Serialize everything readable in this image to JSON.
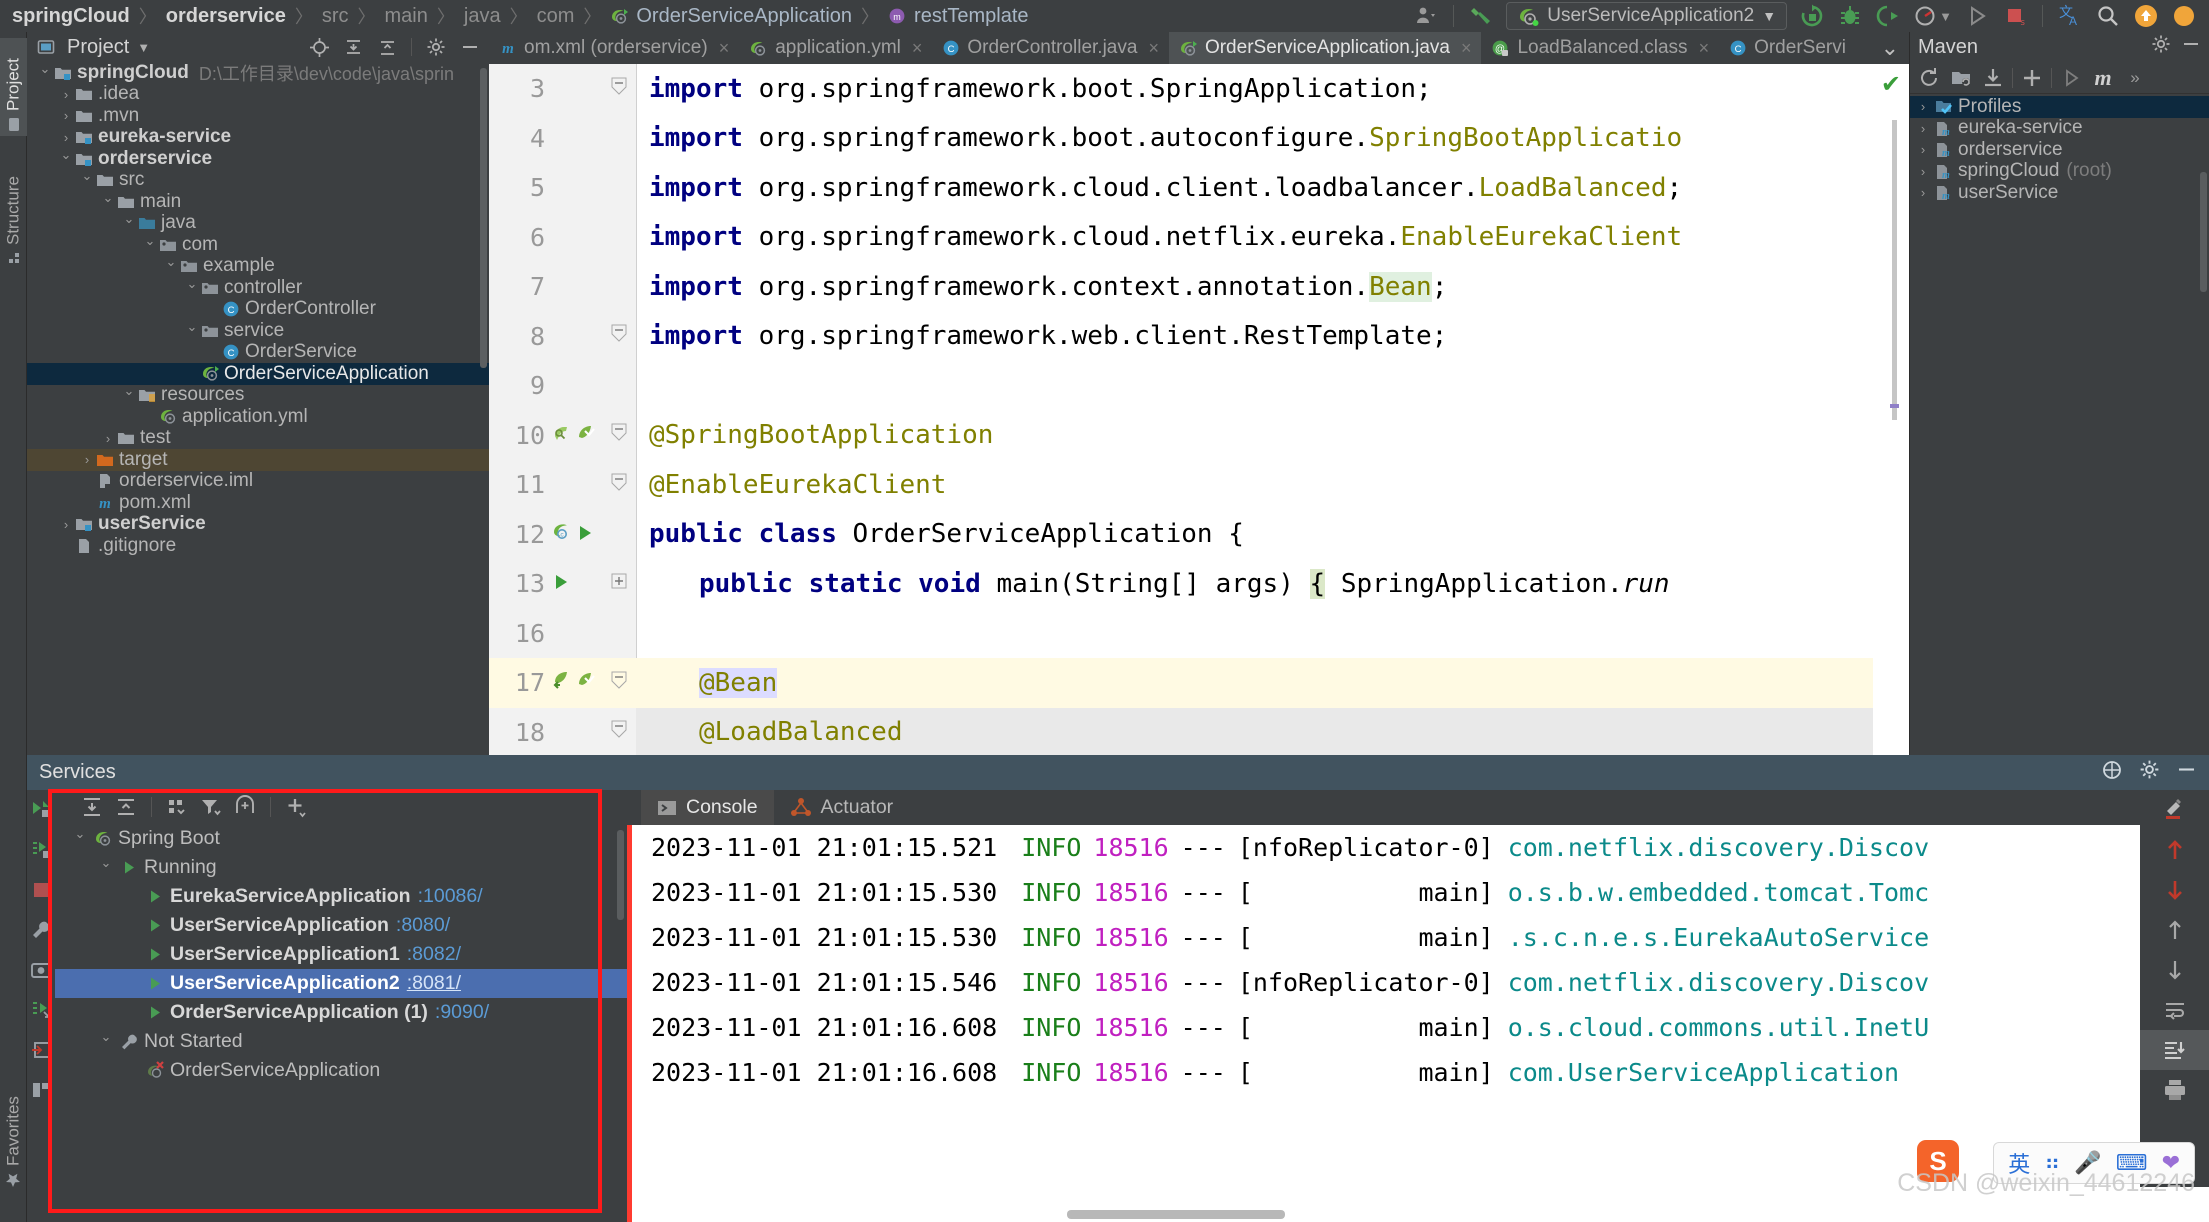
{
  "breadcrumb": {
    "items": [
      {
        "label": "springCloud",
        "style": "bold"
      },
      {
        "label": "orderservice",
        "style": "bold"
      },
      {
        "label": "src",
        "style": "dim"
      },
      {
        "label": "main",
        "style": "dim"
      },
      {
        "label": "java",
        "style": "dim"
      },
      {
        "label": "com",
        "style": "dim"
      },
      {
        "label": "OrderServiceApplication",
        "style": "normal",
        "icon": "spring-class-icon"
      },
      {
        "label": "restTemplate",
        "style": "normal",
        "icon": "method-icon"
      }
    ]
  },
  "toolbar": {
    "account_icon": "account-icon",
    "build_icon": "build-hammer-icon",
    "run_config": "UserServiceApplication2",
    "run_config_icon": "spring-boot-icon",
    "icons": [
      "rerun-icon",
      "debug-icon",
      "run-with-coverage-icon",
      "profiler-icon",
      "run-icon",
      "stop-icon",
      "translate-icon",
      "search-icon",
      "update-icon",
      "notifications-icon"
    ]
  },
  "left_strip": {
    "tabs": [
      {
        "label": "Project",
        "icon": "project-folder-icon",
        "selected": true
      },
      {
        "label": "Structure",
        "icon": "structure-icon",
        "selected": false
      }
    ],
    "bottom_tabs": [
      {
        "label": "Favorites",
        "icon": "star-icon"
      }
    ]
  },
  "project_panel": {
    "title": "Project",
    "dropdown_icon": "chevron-down-icon",
    "actions": [
      "locate-icon",
      "expand-all-icon",
      "collapse-all-icon",
      "gear-icon",
      "hide-icon"
    ],
    "tree": [
      {
        "label": "springCloud",
        "path": "D:\\工作目录\\dev\\code\\java\\sprin",
        "indent": 0,
        "arrow": "down",
        "icon": "module-folder-icon",
        "bold": true
      },
      {
        "label": ".idea",
        "indent": 1,
        "arrow": "right",
        "icon": "folder-icon"
      },
      {
        "label": ".mvn",
        "indent": 1,
        "arrow": "right",
        "icon": "folder-icon"
      },
      {
        "label": "eureka-service",
        "indent": 1,
        "arrow": "right",
        "icon": "module-folder-icon",
        "bold": true
      },
      {
        "label": "orderservice",
        "indent": 1,
        "arrow": "down",
        "icon": "module-folder-icon",
        "bold": true
      },
      {
        "label": "src",
        "indent": 2,
        "arrow": "down",
        "icon": "folder-icon"
      },
      {
        "label": "main",
        "indent": 3,
        "arrow": "down",
        "icon": "folder-icon"
      },
      {
        "label": "java",
        "indent": 4,
        "arrow": "down",
        "icon": "source-folder-icon"
      },
      {
        "label": "com",
        "indent": 5,
        "arrow": "down",
        "icon": "package-icon"
      },
      {
        "label": "example",
        "indent": 6,
        "arrow": "down",
        "icon": "package-icon"
      },
      {
        "label": "controller",
        "indent": 7,
        "arrow": "down",
        "icon": "package-icon"
      },
      {
        "label": "OrderController",
        "indent": 8,
        "arrow": "none",
        "icon": "class-icon"
      },
      {
        "label": "service",
        "indent": 7,
        "arrow": "down",
        "icon": "package-icon"
      },
      {
        "label": "OrderService",
        "indent": 8,
        "arrow": "none",
        "icon": "class-icon"
      },
      {
        "label": "OrderServiceApplication",
        "indent": 7,
        "arrow": "none",
        "icon": "spring-class-icon",
        "selected": true
      },
      {
        "label": "resources",
        "indent": 4,
        "arrow": "down",
        "icon": "resources-folder-icon"
      },
      {
        "label": "application.yml",
        "indent": 5,
        "arrow": "none",
        "icon": "spring-yaml-icon"
      },
      {
        "label": "test",
        "indent": 3,
        "arrow": "right",
        "icon": "folder-icon"
      },
      {
        "label": "target",
        "indent": 2,
        "arrow": "right",
        "icon": "target-folder-icon",
        "highlight": "target"
      },
      {
        "label": "orderservice.iml",
        "indent": 2,
        "arrow": "none",
        "icon": "iml-icon"
      },
      {
        "label": "pom.xml",
        "indent": 2,
        "arrow": "none",
        "icon": "maven-icon"
      },
      {
        "label": "userService",
        "indent": 1,
        "arrow": "right",
        "icon": "module-folder-icon",
        "bold": true
      },
      {
        "label": ".gitignore",
        "indent": 1,
        "arrow": "none",
        "icon": "file-icon"
      }
    ]
  },
  "editor": {
    "tabs": [
      {
        "label": "om.xml (orderservice)",
        "icon": "maven-icon",
        "active": false,
        "closable": true
      },
      {
        "label": "application.yml",
        "icon": "spring-yaml-icon",
        "active": false,
        "closable": true
      },
      {
        "label": "OrderController.java",
        "icon": "class-icon",
        "active": false,
        "closable": true
      },
      {
        "label": "OrderServiceApplication.java",
        "icon": "spring-class-icon",
        "active": true,
        "closable": true
      },
      {
        "label": "LoadBalanced.class",
        "icon": "annotation-class-icon",
        "active": false,
        "closable": true
      },
      {
        "label": "OrderServi",
        "icon": "class-icon",
        "active": false,
        "closable": false
      }
    ],
    "overflow_icon": "chevron-down-icon",
    "inspection_icon": "inspection-ok-icon",
    "lines": [
      {
        "num": "3",
        "fold": "minus",
        "gutter": [],
        "segments": [
          {
            "t": "import ",
            "c": "kw"
          },
          {
            "t": "org.springframework.boot.SpringApplication;",
            "c": "plain"
          }
        ]
      },
      {
        "num": "4",
        "fold": "none",
        "gutter": [],
        "segments": [
          {
            "t": "import ",
            "c": "kw"
          },
          {
            "t": "org.springframework.boot.autoconfigure.",
            "c": "plain"
          },
          {
            "t": "SpringBootApplicatio",
            "c": "anno"
          }
        ]
      },
      {
        "num": "5",
        "fold": "none",
        "gutter": [],
        "segments": [
          {
            "t": "import ",
            "c": "kw"
          },
          {
            "t": "org.springframework.cloud.client.loadbalancer.",
            "c": "plain"
          },
          {
            "t": "LoadBalanced",
            "c": "anno"
          },
          {
            "t": ";",
            "c": "plain"
          }
        ]
      },
      {
        "num": "6",
        "fold": "none",
        "gutter": [],
        "segments": [
          {
            "t": "import ",
            "c": "kw"
          },
          {
            "t": "org.springframework.cloud.netflix.eureka.",
            "c": "plain"
          },
          {
            "t": "EnableEurekaClient",
            "c": "anno"
          }
        ]
      },
      {
        "num": "7",
        "fold": "none",
        "gutter": [],
        "segments": [
          {
            "t": "import ",
            "c": "kw"
          },
          {
            "t": "org.springframework.context.annotation.",
            "c": "plain"
          },
          {
            "t": "Bean",
            "c": "anno-hl"
          },
          {
            "t": ";",
            "c": "plain"
          }
        ]
      },
      {
        "num": "8",
        "fold": "minus",
        "gutter": [],
        "segments": [
          {
            "t": "import ",
            "c": "kw"
          },
          {
            "t": "org.springframework.web.client.RestTemplate;",
            "c": "plain"
          }
        ]
      },
      {
        "num": "9",
        "fold": "none",
        "gutter": [],
        "segments": []
      },
      {
        "num": "10",
        "fold": "minus",
        "gutter": [
          "inspection-magnifier-icon",
          "spring-bean-leaf-icon"
        ],
        "segments": [
          {
            "t": "@SpringBootApplication",
            "c": "anno"
          }
        ]
      },
      {
        "num": "11",
        "fold": "minus-small",
        "gutter": [],
        "segments": [
          {
            "t": "@EnableEurekaClient",
            "c": "anno"
          }
        ]
      },
      {
        "num": "12",
        "fold": "none",
        "gutter": [
          "spring-class-gutter-icon",
          "run-gutter-icon"
        ],
        "segments": [
          {
            "t": "public ",
            "c": "kw"
          },
          {
            "t": "class ",
            "c": "kw"
          },
          {
            "t": "OrderServiceApplication ",
            "c": "plain"
          },
          {
            "t": "{",
            "c": "plain"
          }
        ]
      },
      {
        "num": "13",
        "fold": "plus",
        "gutter": [
          "run-gutter-icon"
        ],
        "indent": 1,
        "segments": [
          {
            "t": "public ",
            "c": "kw"
          },
          {
            "t": "static ",
            "c": "kw"
          },
          {
            "t": "void ",
            "c": "kw"
          },
          {
            "t": "main",
            "c": "plain"
          },
          {
            "t": "(",
            "c": "plain"
          },
          {
            "t": "String",
            "c": "plain"
          },
          {
            "t": "[] args) ",
            "c": "plain"
          },
          {
            "t": "{",
            "c": "brace"
          },
          {
            "t": " SpringApplication.",
            "c": "plain"
          },
          {
            "t": "run",
            "c": "italic"
          }
        ]
      },
      {
        "num": "16",
        "fold": "none",
        "gutter": [],
        "segments": []
      },
      {
        "num": "17",
        "fold": "minus",
        "gutter": [
          "override-arrow-icon",
          "spring-bean-leaf-icon"
        ],
        "highlight": "yellow",
        "indent": 1,
        "segments": [
          {
            "t": "@Bean",
            "c": "anno-sel"
          }
        ]
      },
      {
        "num": "18",
        "fold": "minus-small",
        "gutter": [],
        "highlight": "gray",
        "indent": 1,
        "segments": [
          {
            "t": "@LoadBalanced",
            "c": "anno"
          }
        ]
      }
    ]
  },
  "maven_panel": {
    "title": "Maven",
    "header_actions": [
      "gear-icon",
      "hide-icon"
    ],
    "toolbar_icons": [
      "reload-icon",
      "add-module-icon",
      "download-sources-icon",
      "plus-icon",
      "run-icon",
      "maven-goal-icon",
      "more-icon"
    ],
    "tree": [
      {
        "label": "Profiles",
        "icon": "profiles-icon",
        "arrow": "right",
        "selected": true
      },
      {
        "label": "eureka-service",
        "icon": "maven-module-icon",
        "arrow": "right"
      },
      {
        "label": "orderservice",
        "icon": "maven-module-icon",
        "arrow": "right"
      },
      {
        "label": "springCloud",
        "suffix": "(root)",
        "icon": "maven-module-icon",
        "arrow": "right"
      },
      {
        "label": "userService",
        "icon": "maven-module-icon",
        "arrow": "right"
      }
    ]
  },
  "services": {
    "title": "Services",
    "header_actions": [
      "help-icon",
      "gear-icon",
      "hide-icon"
    ],
    "toolbar_icons": [
      "expand-all-icon",
      "collapse-all-icon",
      "group-by-icon",
      "filter-icon",
      "add-tab-icon",
      "add-service-icon"
    ],
    "side_icons": [
      "run-icon",
      "rerun-icon",
      "stop-icon",
      "settings-wrench-icon",
      "screenshot-icon",
      "restart-icon",
      "export-icon",
      "layout-icon"
    ],
    "tree": [
      {
        "label": "Spring Boot",
        "indent": 0,
        "arrow": "down",
        "icon": "spring-boot-icon"
      },
      {
        "label": "Running",
        "indent": 1,
        "arrow": "down",
        "icon": "run-green-icon"
      },
      {
        "label": "EurekaServiceApplication",
        "port": ":10086/",
        "indent": 2,
        "arrow": "none",
        "icon": "run-green-icon",
        "bold": true
      },
      {
        "label": "UserServiceApplication",
        "port": ":8080/",
        "indent": 2,
        "arrow": "none",
        "icon": "run-green-icon",
        "bold": true
      },
      {
        "label": "UserServiceApplication1",
        "port": ":8082/",
        "indent": 2,
        "arrow": "none",
        "icon": "run-green-icon",
        "bold": true
      },
      {
        "label": "UserServiceApplication2",
        "port": ":8081/",
        "indent": 2,
        "arrow": "none",
        "icon": "run-green-icon",
        "bold": true,
        "selected": true
      },
      {
        "label": "OrderServiceApplication (1)",
        "port": ":9090/",
        "indent": 2,
        "arrow": "none",
        "icon": "run-green-icon",
        "bold": true
      },
      {
        "label": "Not Started",
        "indent": 1,
        "arrow": "down",
        "icon": "wrench-icon"
      },
      {
        "label": "OrderServiceApplication",
        "indent": 2,
        "arrow": "none",
        "icon": "spring-boot-stopped-icon"
      }
    ]
  },
  "console": {
    "tabs": [
      {
        "label": "Console",
        "icon": "console-icon",
        "active": true
      },
      {
        "label": "Actuator",
        "icon": "actuator-icon",
        "active": false
      }
    ],
    "side_icons": [
      "soft-wrap-icon",
      "prev-occurrence-up-icon",
      "next-occurrence-down-icon",
      "scroll-up-icon",
      "scroll-down-icon",
      "soft-wrap-lines-icon",
      "scroll-to-end-icon",
      "print-icon"
    ],
    "lines": [
      {
        "ts": "2023-11-01 21:01:15.521",
        "level": "INFO",
        "pid": "18516",
        "dash": "---",
        "thread": "[nfoReplicator-0]",
        "logger": "com.netflix.discovery.Discov"
      },
      {
        "ts": "2023-11-01 21:01:15.530",
        "level": "INFO",
        "pid": "18516",
        "dash": "---",
        "thread": "[           main]",
        "logger": "o.s.b.w.embedded.tomcat.Tomc"
      },
      {
        "ts": "2023-11-01 21:01:15.530",
        "level": "INFO",
        "pid": "18516",
        "dash": "---",
        "thread": "[           main]",
        "logger": ".s.c.n.e.s.EurekaAutoService"
      },
      {
        "ts": "2023-11-01 21:01:15.546",
        "level": "INFO",
        "pid": "18516",
        "dash": "---",
        "thread": "[nfoReplicator-0]",
        "logger": "com.netflix.discovery.Discov"
      },
      {
        "ts": "2023-11-01 21:01:16.608",
        "level": "INFO",
        "pid": "18516",
        "dash": "---",
        "thread": "[           main]",
        "logger": "o.s.cloud.commons.util.InetU"
      },
      {
        "ts": "2023-11-01 21:01:16.608",
        "level": "INFO",
        "pid": "18516",
        "dash": "---",
        "thread": "[           main]",
        "logger": "com.UserServiceApplication"
      }
    ]
  },
  "watermark": {
    "text": "CSDN @weixin_44612246"
  },
  "ime": {
    "logo": "S",
    "icons": [
      "chinese-input-icon",
      "pinyin-dot-icon",
      "microphone-icon",
      "keyboard-icon",
      "heart-icon"
    ]
  },
  "colors": {
    "accent": "#4b6eaf",
    "annotation_red": "#ff1a1a",
    "link_blue": "#5b9bd5",
    "running_green": "#499c54",
    "log_info_green": "#1a7f1a",
    "log_pid_magenta": "#c020c0",
    "log_logger_teal": "#0b8a8a"
  }
}
